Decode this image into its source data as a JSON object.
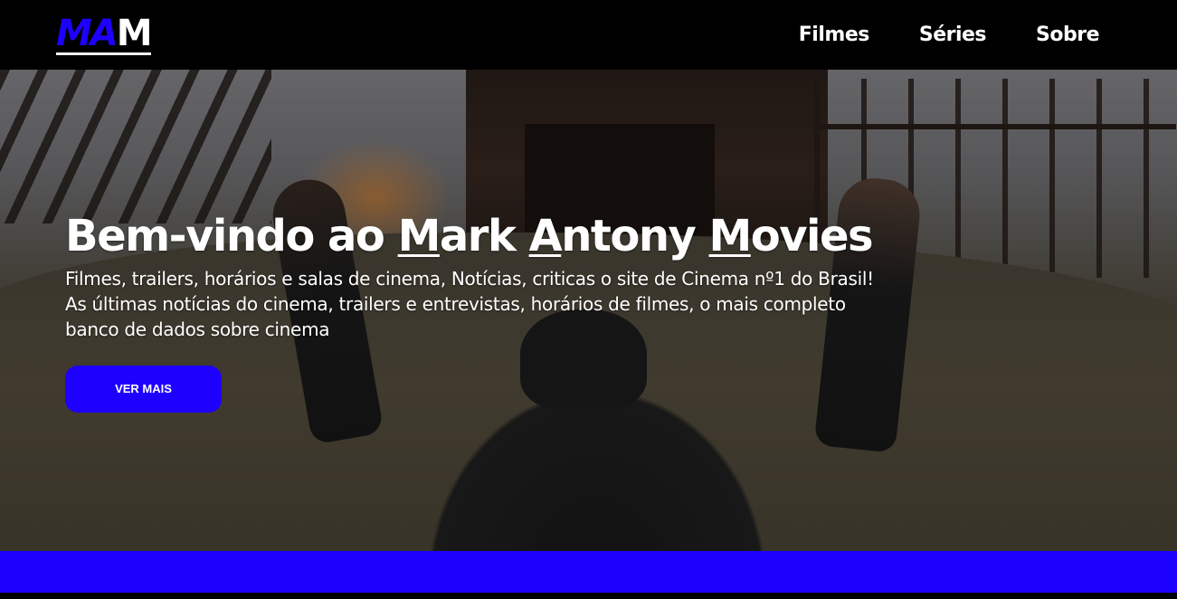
{
  "header": {
    "logo_accent": "MA",
    "logo_rest": "M",
    "nav": [
      {
        "label": "Filmes"
      },
      {
        "label": "Séries"
      },
      {
        "label": "Sobre"
      }
    ]
  },
  "hero": {
    "title_prefix": "Bem-vindo ao ",
    "title_parts": [
      {
        "initial": "M",
        "rest": "ark "
      },
      {
        "initial": "A",
        "rest": "ntony "
      },
      {
        "initial": "M",
        "rest": "ovies"
      }
    ],
    "description": "Filmes, trailers, horários e salas de cinema, Notícias, criticas o site de Cinema nº1 do Brasil! As últimas notícias do cinema, trailers e entrevistas, horários de filmes, o mais completo banco de dados sobre cinema",
    "cta_label": "VER MAIS"
  },
  "colors": {
    "accent": "#1e00ff",
    "header_bg": "#000000",
    "text": "#ffffff"
  }
}
